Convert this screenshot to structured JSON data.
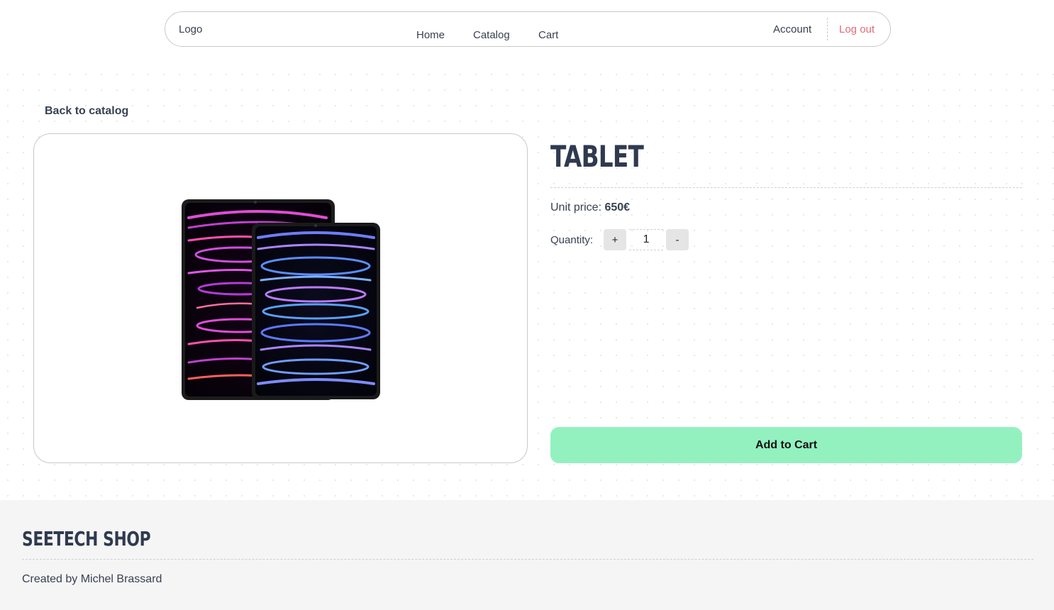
{
  "nav": {
    "logo": "Logo",
    "links": [
      "Home",
      "Catalog",
      "Cart"
    ],
    "account": "Account",
    "logout": "Log out"
  },
  "back_link": "Back to catalog",
  "product": {
    "title": "TABLET",
    "price_label": "Unit price:",
    "price_value": "650€",
    "quantity_label": "Quantity:",
    "quantity_value": "1",
    "increment_label": "+",
    "decrement_label": "-",
    "add_to_cart": "Add to Cart",
    "image_icon": "tablet-product-image"
  },
  "footer": {
    "title": "SEETECH SHOP",
    "credit": "Created by Michel Brassard"
  },
  "colors": {
    "accent_green": "#93f1bf",
    "logout_red": "#e06c75",
    "title_dark": "#2f3a4f"
  }
}
